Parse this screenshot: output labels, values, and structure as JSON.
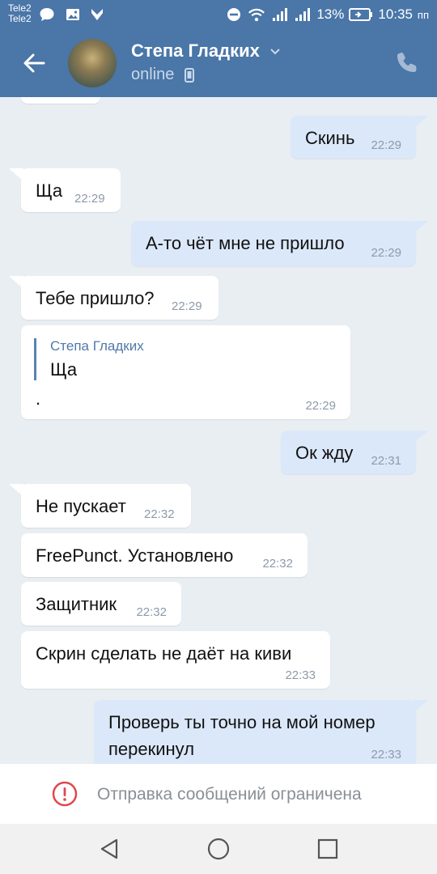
{
  "status_bar": {
    "carrier_1": "Tele2",
    "carrier_2": "Tele2",
    "battery": "13%",
    "time": "10:35",
    "ampm": "пп"
  },
  "header": {
    "name": "Степа Гладких",
    "status": "online"
  },
  "messages": [
    {
      "dir": "out",
      "text": "Скинь",
      "time": "22:29"
    },
    {
      "dir": "in",
      "text": "Ща",
      "time": "22:29"
    },
    {
      "dir": "out",
      "text": "А-то чёт мне не пришло",
      "time": "22:29"
    },
    {
      "dir": "in",
      "text": "Тебе пришло?",
      "time": "22:29"
    },
    {
      "dir": "in",
      "reply_name": "Степа Гладких",
      "reply_text": "Ща",
      "text": ".",
      "time": "22:29"
    },
    {
      "dir": "out",
      "text": "Ок жду",
      "time": "22:31"
    },
    {
      "dir": "in",
      "text": "Не пускает",
      "time": "22:32"
    },
    {
      "dir": "in",
      "text": "FreePunct. Установлено",
      "time": "22:32"
    },
    {
      "dir": "in",
      "text": "Защитник",
      "time": "22:32"
    },
    {
      "dir": "in",
      "text": "Скрин сделать не даёт на киви",
      "time": "22:33"
    },
    {
      "dir": "out",
      "text_line1": "Проверь ты точно на мой номер",
      "text_line2": "перекинул",
      "time": "22:33"
    }
  ],
  "restriction": {
    "text": "Отправка сообщений ограничена"
  },
  "colors": {
    "header": "#4a76a8",
    "incoming": "#ffffff",
    "outgoing": "#dbe8fa",
    "background": "#e9eef3",
    "warning": "#e0474c"
  }
}
